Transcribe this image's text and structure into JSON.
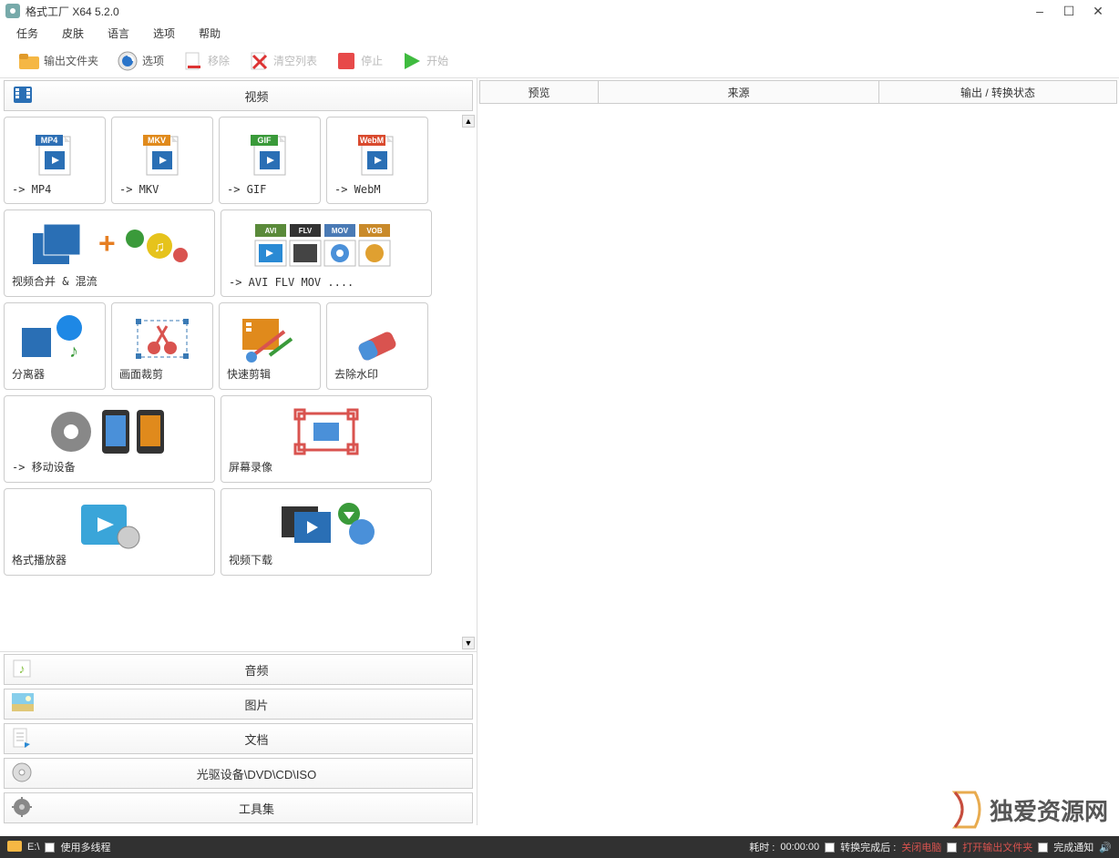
{
  "window": {
    "title": "格式工厂 X64 5.2.0"
  },
  "menu": [
    "任务",
    "皮肤",
    "语言",
    "选项",
    "帮助"
  ],
  "toolbar": {
    "output_folder": "输出文件夹",
    "options": "选项",
    "remove": "移除",
    "clear_list": "清空列表",
    "stop": "停止",
    "start": "开始"
  },
  "categories": {
    "video": "视频",
    "audio": "音频",
    "picture": "图片",
    "document": "文档",
    "optical": "光驱设备\\DVD\\CD\\ISO",
    "toolset": "工具集"
  },
  "video_tiles": [
    {
      "name": "to-mp4",
      "label": "-> MP4",
      "badge": "MP4",
      "badge_color": "#2d6fb5",
      "w": 1
    },
    {
      "name": "to-mkv",
      "label": "-> MKV",
      "badge": "MKV",
      "badge_color": "#e08a1c",
      "w": 1
    },
    {
      "name": "to-gif",
      "label": "-> GIF",
      "badge": "GIF",
      "badge_color": "#3a9a3a",
      "w": 1
    },
    {
      "name": "to-webm",
      "label": "-> WebM",
      "badge": "WebM",
      "badge_color": "#d94a2e",
      "w": 1
    },
    {
      "name": "video-merge-mix",
      "label": "视频合并 & 混流",
      "w": 2
    },
    {
      "name": "to-avi-flv-mov",
      "label": "-> AVI FLV MOV ....",
      "w": 2,
      "multi_badges": [
        "AVI",
        "FLV",
        "MOV",
        "VOB"
      ]
    },
    {
      "name": "splitter",
      "label": "分离器",
      "w": 1
    },
    {
      "name": "crop",
      "label": "画面裁剪",
      "w": 1
    },
    {
      "name": "quick-trim",
      "label": "快速剪辑",
      "w": 1
    },
    {
      "name": "remove-watermark",
      "label": "去除水印",
      "w": 1
    },
    {
      "name": "to-mobile",
      "label": "-> 移动设备",
      "w": 2
    },
    {
      "name": "screen-record",
      "label": "屏幕录像",
      "w": 2
    },
    {
      "name": "format-player",
      "label": "格式播放器",
      "w": 2
    },
    {
      "name": "video-download",
      "label": "视频下载",
      "w": 2
    }
  ],
  "right_columns": {
    "preview": "预览",
    "source": "来源",
    "status": "输出 / 转换状态"
  },
  "status": {
    "drive": "E:\\",
    "multithread": "使用多线程",
    "elapsed_label": "耗时 :",
    "elapsed_value": "00:00:00",
    "after_convert": "转换完成后 :",
    "shutdown": "关闭电脑",
    "open_folder": "打开输出文件夹",
    "notify": "完成通知"
  },
  "watermark": "独爱资源网"
}
